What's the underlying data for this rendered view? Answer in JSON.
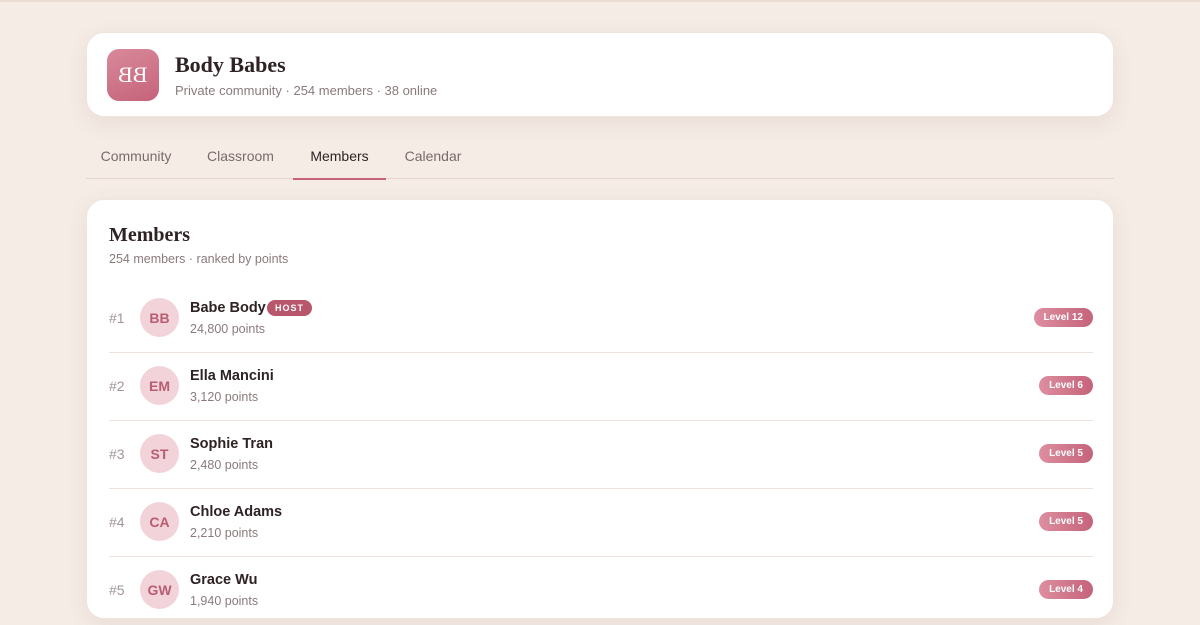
{
  "community": {
    "logo_text": "BB",
    "name": "Body Babes",
    "meta": "Private community · 254 members · 38 online"
  },
  "tabs": [
    {
      "label": "Community"
    },
    {
      "label": "Classroom"
    },
    {
      "label": "Members",
      "active": true
    },
    {
      "label": "Calendar"
    }
  ],
  "members_section": {
    "title": "Members",
    "subtitle": "254 members · ranked by points",
    "host_badge": "HOST",
    "rows": [
      {
        "rank": "#1",
        "initials": "BB",
        "name": "Babe Body",
        "points": "24,800 points",
        "level": "Level 12"
      },
      {
        "rank": "#2",
        "initials": "EM",
        "name": "Ella Mancini",
        "points": "3,120 points",
        "level": "Level 6"
      },
      {
        "rank": "#3",
        "initials": "ST",
        "name": "Sophie Tran",
        "points": "2,480 points",
        "level": "Level 5"
      },
      {
        "rank": "#4",
        "initials": "CA",
        "name": "Chloe Adams",
        "points": "2,210 points",
        "level": "Level 5"
      },
      {
        "rank": "#5",
        "initials": "GW",
        "name": "Grace Wu",
        "points": "1,940 points",
        "level": "Level 4"
      }
    ]
  },
  "colors": {
    "background": "#f5ece6",
    "accent": "#c5637a",
    "avatar_bg": "#f3d3da"
  }
}
